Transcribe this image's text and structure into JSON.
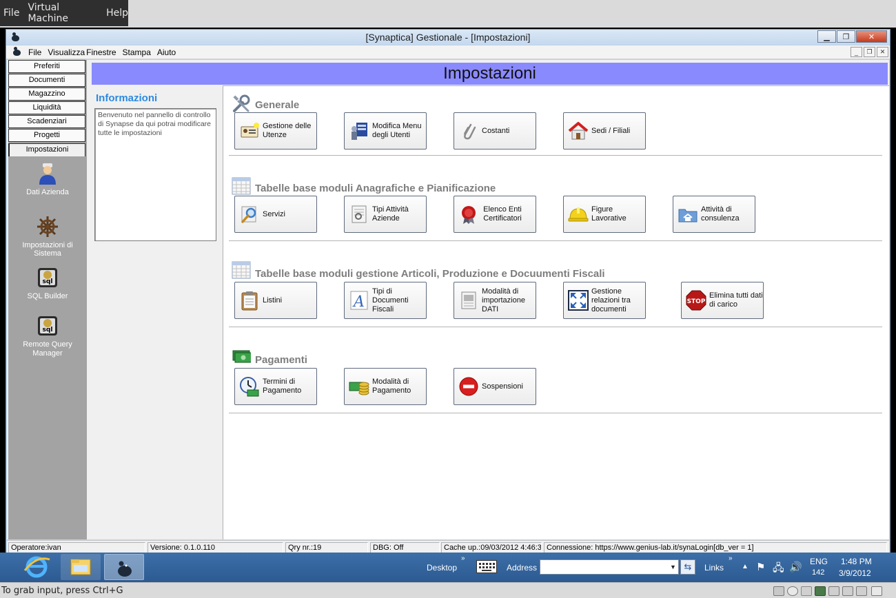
{
  "host": {
    "menu": [
      "File",
      "Virtual Machine",
      "Help"
    ],
    "status_text": "To grab input, press Ctrl+G"
  },
  "window": {
    "title": "[Synaptica] Gestionale - [Impostazioni]",
    "menu": [
      "File",
      "Visualizza",
      "Finestre",
      "Stampa",
      "Aiuto"
    ]
  },
  "nav": {
    "buttons": [
      "Preferiti",
      "Documenti",
      "Magazzino",
      "Liquidità",
      "Scadenziari",
      "Progetti",
      "Impostazioni"
    ],
    "active": "Impostazioni",
    "tools": [
      {
        "label": "Dati Azienda",
        "icon": "person-icon"
      },
      {
        "label": "Impostazioni di Sistema",
        "icon": "helm-icon"
      },
      {
        "label": "SQL Builder",
        "icon": "sql-icon"
      },
      {
        "label": "Remote Query Manager",
        "icon": "sql-icon"
      }
    ]
  },
  "header": {
    "title": "Impostazioni"
  },
  "info": {
    "title": "Informazioni",
    "text": "Benvenuto nel pannello di controllo di Synapse da qui potrai modificare tutte le impostazioni"
  },
  "sections": [
    {
      "title": "Generale",
      "tiles": [
        "Gestione delle Utenze",
        "Modifica Menu degli Utenti",
        "Costanti",
        "Sedi / Filiali"
      ]
    },
    {
      "title": "Tabelle base moduli Anagrafiche e Pianificazione",
      "tiles": [
        "Servizi",
        "Tipi Attività Aziende",
        "Elenco Enti Certificatori",
        "Figure Lavorative",
        "Attività di consulenza"
      ]
    },
    {
      "title": "Tabelle base moduli gestione Articoli, Produzione e Docuumenti Fiscali",
      "tiles": [
        "Listini",
        "Tipi di Documenti Fiscali",
        "Modalità di importazione DATI",
        "Gestione relazioni tra documenti",
        "Elimina tutti dati di carico"
      ]
    },
    {
      "title": "Pagamenti",
      "tiles": [
        "Termini di Pagamento",
        "Modalità di Pagamento",
        "Sospensioni"
      ]
    }
  ],
  "statusbar": {
    "operator": "Operatore:ivan",
    "version": "Versione: 0.1.0.110",
    "qry": "Qry nr.:19",
    "dbg": "DBG: Off",
    "cache": "Cache up.:09/03/2012 4:46:3",
    "connection": "Connessione: https://www.genius-lab.it/synaLogin[db_ver = 1]"
  },
  "taskbar": {
    "desktop": "Desktop",
    "address_label": "Address",
    "address_value": "",
    "links": "Links",
    "lang": "ENG",
    "lang_sub": "142",
    "time": "1:48 PM",
    "date": "3/9/2012"
  },
  "colors": {
    "header_bg": "#8a8aff",
    "info_title": "#2c8ae0",
    "taskbar": "#2c5a91"
  }
}
